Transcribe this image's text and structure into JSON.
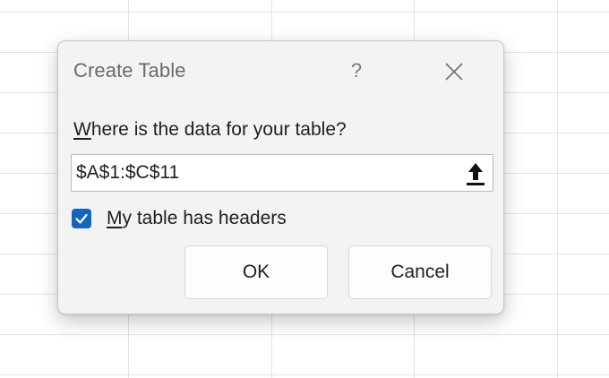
{
  "dialog": {
    "title": "Create Table",
    "help_label": "?",
    "prompt_first_letter": "W",
    "prompt_rest": "here is the data for your table?",
    "range_value": "$A$1:$C$11",
    "checkbox": {
      "checked": true,
      "label_first_letter": "M",
      "label_rest": "y table has headers"
    },
    "ok_label": "OK",
    "cancel_label": "Cancel"
  },
  "colors": {
    "accent": "#1565c0",
    "dialog_bg": "#f3f3f3",
    "grid_line": "#e3e3e3"
  },
  "icons": {
    "close": "close-icon",
    "collapse": "collapse-dialog-arrow-icon",
    "check": "checkmark-icon"
  }
}
